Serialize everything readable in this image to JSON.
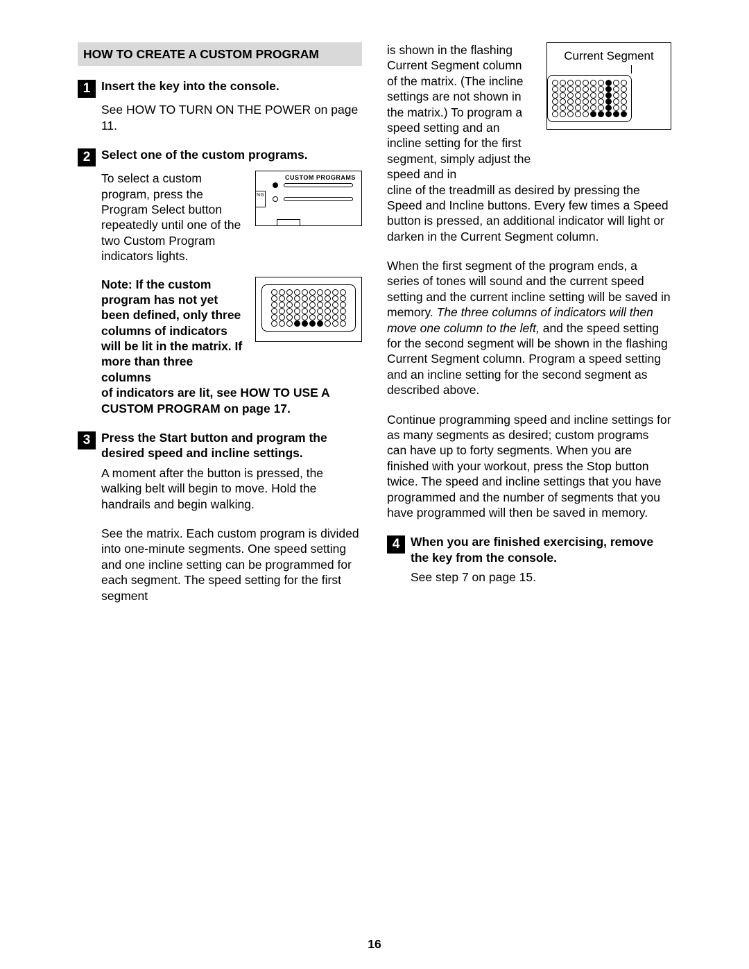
{
  "left": {
    "sectionTitle": "HOW TO CREATE A CUSTOM PROGRAM",
    "step1": {
      "num": "1",
      "title": "Insert the key into the console.",
      "body": "See HOW TO TURN ON THE POWER on page 11."
    },
    "step2": {
      "num": "2",
      "title": "Select one of the custom programs.",
      "selectText": "To select a custom program, press the Program Select button repeatedly until one of the two Custom Program indicators lights.",
      "panelLabel": "CUSTOM PROGRAMS",
      "panelSideLabel": "NG",
      "note": "Note: If the custom program has not yet been defined, only three columns of indicators will be lit in the matrix. If more than three columns of indicators are lit, see HOW TO USE A CUSTOM PROGRAM on page 17."
    },
    "step3": {
      "num": "3",
      "title": "Press the Start button and program the desired speed and incline settings.",
      "p1": "A moment after the button is pressed, the walking belt will begin to move. Hold the handrails and begin walking.",
      "p2": "See the matrix. Each custom program is divided into one-minute segments. One speed setting and one incline setting can be programmed for each segment. The speed setting for the first segment"
    }
  },
  "right": {
    "csLabel": "Current Segment",
    "p1a": "is shown in the flashing Current Segment column of the matrix. (The incline settings are not shown in the matrix.) To program a speed setting and an incline setting for the first segment, simply adjust the speed and in",
    "p1b": "cline of the treadmill as desired by pressing the Speed and Incline buttons. Every few times a Speed button is pressed, an additional indicator will light or darken in the Current Segment column.",
    "p2a": "When the first segment of the program ends, a series of tones will sound and the current speed setting and the current incline setting will be saved in memory. ",
    "p2italic": "The three columns of indicators will then move one column to the left,",
    "p2b": " and the speed setting for the second segment will be shown in the flashing Current Segment column. Program a speed setting and an incline setting for the second segment as described above.",
    "p3": "Continue programming speed and incline settings for as many segments as desired; custom programs can have up to forty segments. When you are finished with your workout, press the Stop button twice. The speed and incline settings that you have programmed and the number of segments that you have programmed will then be saved in memory.",
    "step4": {
      "num": "4",
      "title": "When you are finished exercising, remove the key from the console.",
      "body": "See step 7 on page 15."
    }
  },
  "pageNumber": "16",
  "matrixA": {
    "rows": 6,
    "cols": 10,
    "lit": [
      "5,3",
      "5,4",
      "5,5",
      "5,6"
    ]
  },
  "matrixB": {
    "rows": 6,
    "cols": 10,
    "lit": [
      "0,7",
      "1,7",
      "2,7",
      "3,7",
      "4,7",
      "5,5",
      "5,6",
      "5,7",
      "5,8",
      "5,9"
    ]
  }
}
